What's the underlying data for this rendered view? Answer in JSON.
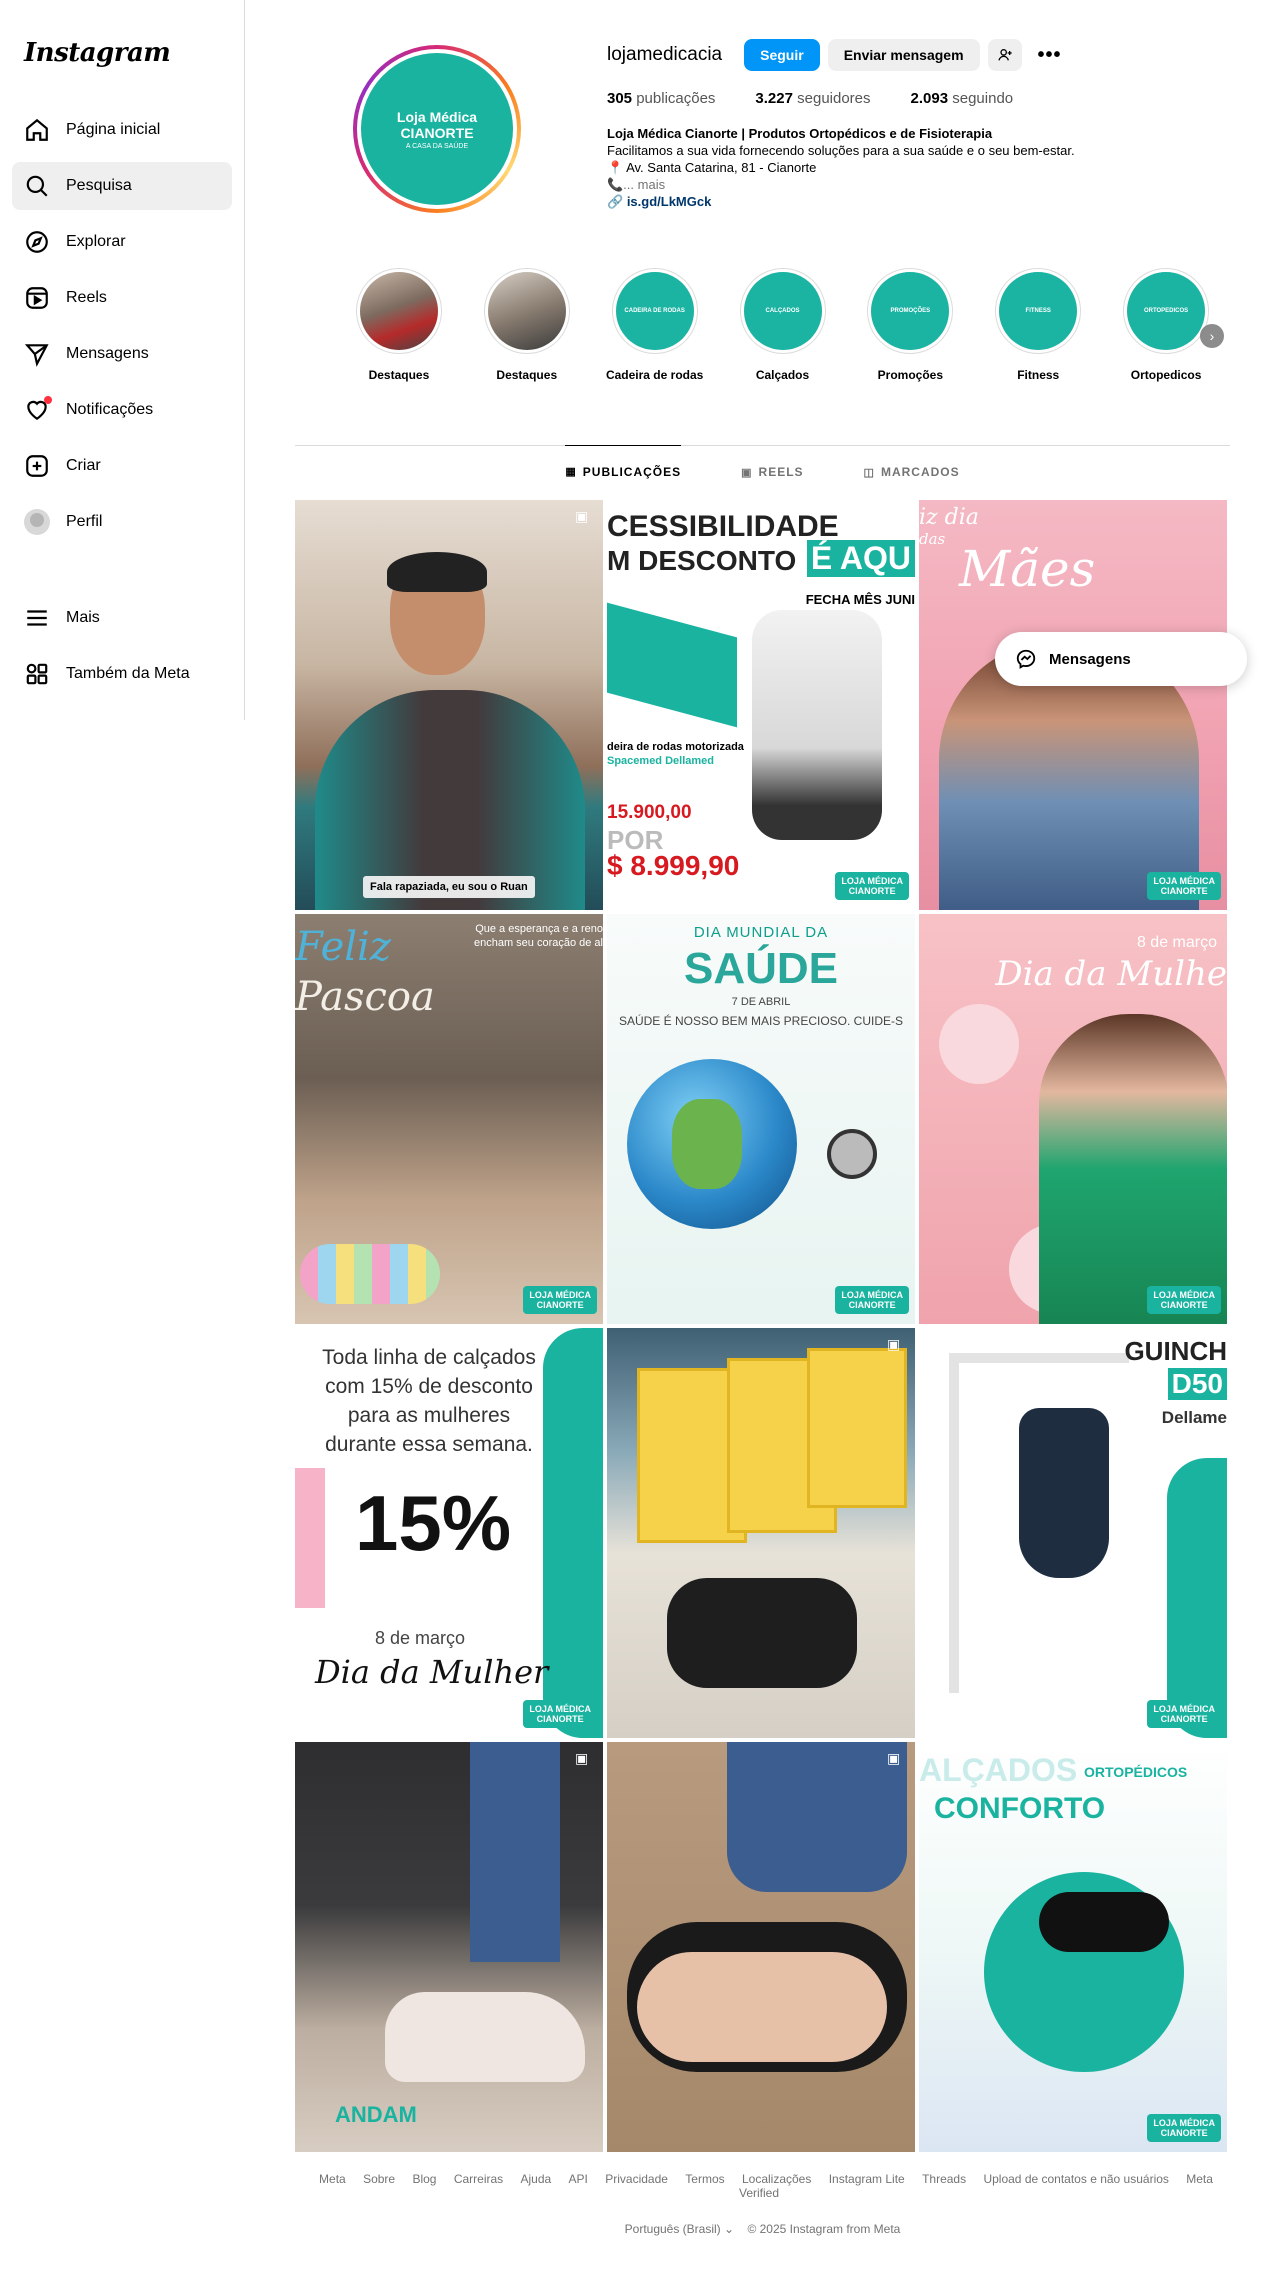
{
  "app": {
    "logo": "Instagram"
  },
  "sidebar": {
    "items": [
      {
        "label": "Página inicial",
        "icon": "home-icon"
      },
      {
        "label": "Pesquisa",
        "icon": "search-icon"
      },
      {
        "label": "Explorar",
        "icon": "compass-icon"
      },
      {
        "label": "Reels",
        "icon": "reels-icon"
      },
      {
        "label": "Mensagens",
        "icon": "send-icon"
      },
      {
        "label": "Notificações",
        "icon": "heart-icon"
      },
      {
        "label": "Criar",
        "icon": "plus-icon"
      },
      {
        "label": "Perfil",
        "icon": "avatar-icon"
      }
    ],
    "more": "Mais",
    "meta": "Também da Meta"
  },
  "profile": {
    "username": "lojamedicacia",
    "follow_label": "Seguir",
    "message_label": "Enviar mensagem",
    "pic_line1": "Loja Médica",
    "pic_line2": "CIANORTE",
    "pic_line3": "A CASA DA SAÚDE",
    "stats": {
      "posts_count": "305",
      "posts_label": "publicações",
      "followers_count": "3.227",
      "followers_label": "seguidores",
      "following_count": "2.093",
      "following_label": "seguindo"
    },
    "bio": {
      "name": "Loja Médica Cianorte | Produtos Ortopédicos e de Fisioterapia",
      "line1": "Facilitamos a sua vida fornecendo soluções para a sua saúde e o seu bem-estar.",
      "line2": "📍 Av. Santa Catarina, 81 - Cianorte",
      "line3": "📞... mais",
      "link": "is.gd/LkMGck"
    }
  },
  "highlights": [
    {
      "label": "Destaques",
      "badge": ""
    },
    {
      "label": "Destaques",
      "badge": ""
    },
    {
      "label": "Cadeira de rodas",
      "badge": "CADEIRA DE RODAS"
    },
    {
      "label": "Calçados",
      "badge": "CALÇADOS"
    },
    {
      "label": "Promoções",
      "badge": "PROMOÇÕES"
    },
    {
      "label": "Fitness",
      "badge": "FITNESS"
    },
    {
      "label": "Ortopedicos",
      "badge": "ORTOPEDICOS"
    }
  ],
  "tabs": [
    {
      "label": "PUBLICAÇÕES",
      "icon": "grid-icon"
    },
    {
      "label": "REELS",
      "icon": "reels-icon"
    },
    {
      "label": "MARCADOS",
      "icon": "tag-icon"
    }
  ],
  "posts": {
    "brand_line1": "LOJA MÉDICA",
    "brand_line2": "CIANORTE",
    "p1_caption": "Fala rapaziada, eu sou o Ruan",
    "p2_t1": "CESSIBILIDADE",
    "p2_t2": "M DESCONTO",
    "p2_t3": "É AQU",
    "p2_t4": "FECHA MÊS JUNI",
    "p2_t5a": "deira de rodas motorizada",
    "p2_t5b": "Spacemed Dellamed",
    "p2_price1": "15.900,00",
    "p2_price2": "POR",
    "p2_price3": "$ 8.999,90",
    "p3_t1": "iz dia",
    "p3_t2": "das",
    "p3_t3": "Mães",
    "p4_t1": "Feliz",
    "p4_t2": "Pascoa",
    "p4_t3a": "Que a esperança e a reno",
    "p4_t3b": "encham seu coração de al",
    "p5_t1": "DIA MUNDIAL DA",
    "p5_t2": "SAÚDE",
    "p5_t3": "7 DE ABRIL",
    "p5_t4": "SAÚDE É NOSSO BEM MAIS PRECIOSO. CUIDE-S",
    "p6_t1": "8 de março",
    "p6_t2": "Dia da Mulhe",
    "p7_t1a": "Toda linha de calçados",
    "p7_t1b": "com 15% de desconto",
    "p7_t1c": "para as mulheres",
    "p7_t1d": "durante essa semana.",
    "p7_t2": "15%",
    "p7_t3": "8 de março",
    "p7_t4": "Dia da Mulher",
    "p9_t1": "GUINCH",
    "p9_t2": "D50",
    "p9_t3": "Dellame",
    "p10_t1": "ANDAM",
    "p12_t1": "ALÇADOS",
    "p12_t2": "ORTOPÉDICOS",
    "p12_t3": "CONFORTO"
  },
  "popup": {
    "label": "Mensagens"
  },
  "footer": {
    "links": [
      "Meta",
      "Sobre",
      "Blog",
      "Carreiras",
      "Ajuda",
      "API",
      "Privacidade",
      "Termos",
      "Localizações",
      "Instagram Lite",
      "Threads",
      "Upload de contatos e não usuários",
      "Meta Verified"
    ],
    "language": "Português (Brasil)",
    "copyright": "© 2025 Instagram from Meta"
  }
}
